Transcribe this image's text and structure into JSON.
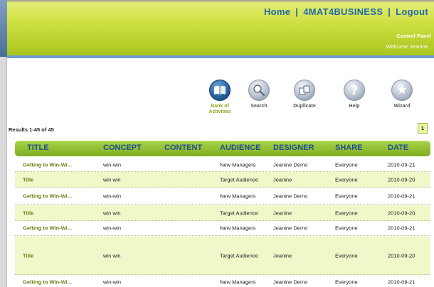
{
  "header": {
    "nav": [
      {
        "label": "Home"
      },
      {
        "label": "4MAT4BUSINESS"
      },
      {
        "label": "Logout"
      }
    ],
    "separator": "|",
    "control_panel": "Control Panel",
    "welcome": "Welcome Jeanine ,"
  },
  "toolbar": {
    "tools": [
      {
        "label_line1": "Bank of",
        "label_line2": "Activities",
        "icon": "book-icon",
        "active": true
      },
      {
        "label_line1": "Search",
        "label_line2": "",
        "icon": "magnifier-icon",
        "active": false
      },
      {
        "label_line1": "Duplicate",
        "label_line2": "",
        "icon": "duplicate-icon",
        "active": false
      },
      {
        "label_line1": "Help",
        "label_line2": "",
        "icon": "question-icon",
        "active": false
      },
      {
        "label_line1": "Wizard",
        "label_line2": "",
        "icon": "star-icon",
        "active": false
      }
    ]
  },
  "results": {
    "text": "Results 1-45 of 45",
    "page": "1"
  },
  "table": {
    "headers": {
      "title": "TITLE",
      "concept": "CONCEPT",
      "content": "CONTENT",
      "audience": "AUDIENCE",
      "designer": "DESIGNER",
      "share": "SHARE",
      "date": "DATE"
    },
    "rows": [
      {
        "title": "Getting to Win-Wi...",
        "concept": "win-win",
        "content": "",
        "audience": "New Managers",
        "designer": "Jeanine Demo",
        "share": "Everyone",
        "date": "2010-09-21"
      },
      {
        "title": "Title",
        "concept": "win win",
        "content": "",
        "audience": "Target Audience",
        "designer": "Jeanine",
        "share": "Everyone",
        "date": "2010-09-20"
      },
      {
        "title": "Getting to Win-Wi...",
        "concept": "win-win",
        "content": "",
        "audience": "New Managers",
        "designer": "Jeanine Demo",
        "share": "Everyone",
        "date": "2010-09-21"
      },
      {
        "title": "Title",
        "concept": "win win",
        "content": "",
        "audience": "Target Audience",
        "designer": "Jeanine",
        "share": "Everyone",
        "date": "2010-09-20"
      },
      {
        "title": "Getting to Win-Wi...",
        "concept": "win-win",
        "content": "",
        "audience": "New Managers",
        "designer": "Jeanine Demo",
        "share": "Everyone",
        "date": "2010-09-21"
      },
      {
        "title": "Title",
        "concept": "win win",
        "content": "",
        "audience": "Target Audience",
        "designer": "Jeanine",
        "share": "Everyone",
        "date": "2010-09-20"
      },
      {
        "title": "Getting to Win-Wi...",
        "concept": "win-win",
        "content": "",
        "audience": "New Managers",
        "designer": "Jeanine Demo",
        "share": "Everyone",
        "date": "2010-09-21"
      }
    ]
  },
  "colors": {
    "header_green": "#cfe043",
    "nav_blue": "#1f6aa8",
    "table_header_green": "#7fae22",
    "alt_row": "#eef8c9",
    "title_text": "#6c7f12"
  }
}
